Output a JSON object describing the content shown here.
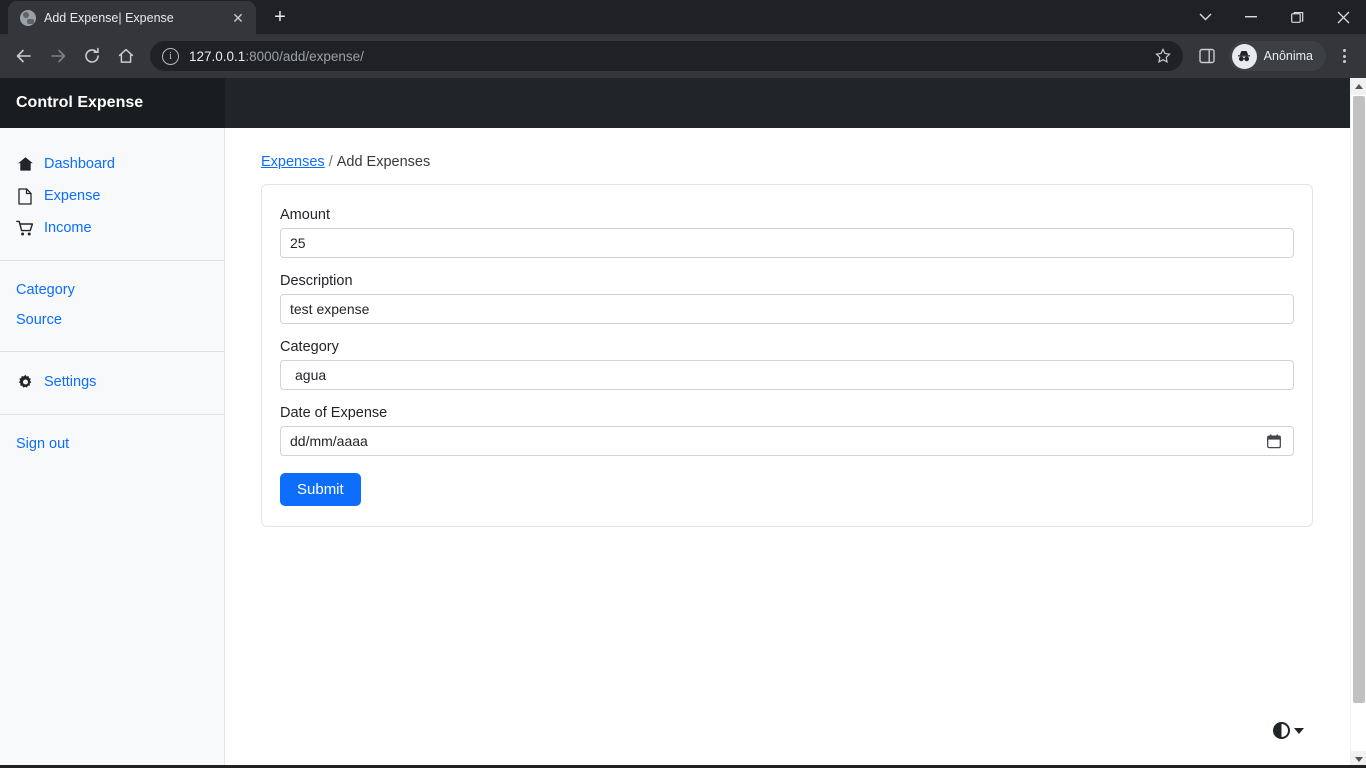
{
  "browser": {
    "tab": {
      "title": "Add Expense| Expense",
      "favicon_icon": "globe-icon",
      "close_icon": "close-icon"
    },
    "new_tab_label": "+",
    "window_controls": [
      {
        "name": "tab-search-button",
        "icon": "chevron-down-icon",
        "glyph": "⌄"
      },
      {
        "name": "minimize-button",
        "icon": "minimize-icon",
        "glyph": "—"
      },
      {
        "name": "maximize-button",
        "icon": "maximize-icon",
        "glyph": "❑"
      },
      {
        "name": "close-window-button",
        "icon": "close-icon",
        "glyph": "✕"
      }
    ],
    "nav": {
      "back_icon": "arrow-left-icon",
      "forward_icon": "arrow-right-icon",
      "reload_icon": "reload-icon",
      "home_icon": "home-icon"
    },
    "omnibox": {
      "info_icon": "info-circle-icon",
      "host": "127.0.0.1",
      "path": ":8000/add/expense/",
      "full_url": "127.0.0.1:8000/add/expense/",
      "bookmark_icon": "star-icon"
    },
    "side_panel_icon": "side-panel-icon",
    "incognito": {
      "label": "Anônima",
      "icon": "incognito-icon"
    },
    "menu_icon": "three-dot-menu-icon"
  },
  "app": {
    "header": {
      "brand": "Control Expense"
    },
    "sidebar": {
      "groups": [
        {
          "items": [
            {
              "label": "Dashboard",
              "icon": "home-icon"
            },
            {
              "label": "Expense",
              "icon": "file-icon"
            },
            {
              "label": "Income",
              "icon": "shopping-cart-icon"
            }
          ]
        },
        {
          "items": [
            {
              "label": "Category",
              "icon": ""
            },
            {
              "label": "Source",
              "icon": ""
            }
          ]
        },
        {
          "items": [
            {
              "label": "Settings",
              "icon": "gear-icon"
            }
          ]
        },
        {
          "items": [
            {
              "label": "Sign out",
              "icon": ""
            }
          ]
        }
      ]
    },
    "breadcrumb": {
      "root": "Expenses",
      "separator": "/",
      "current": "Add Expenses"
    },
    "form": {
      "fields": [
        {
          "label": "Amount",
          "value": "25",
          "type": "text",
          "name": "amount"
        },
        {
          "label": "Description",
          "value": "test expense",
          "type": "text",
          "name": "description"
        },
        {
          "label": "Category",
          "value": "agua",
          "type": "select",
          "name": "category"
        },
        {
          "label": "Date of Expense",
          "value": "dd/mm/aaaa",
          "type": "date",
          "name": "date-of-expense"
        }
      ],
      "submit_label": "Submit"
    },
    "theme_widget": {
      "icon": "contrast-circle-icon",
      "caret_icon": "caret-down-icon"
    }
  },
  "colors": {
    "accent": "#0d6efd",
    "header_dark": "#212529",
    "brand_dark": "#1a1d20",
    "sidebar_bg": "#f8f9fa",
    "border": "#ced4da"
  }
}
